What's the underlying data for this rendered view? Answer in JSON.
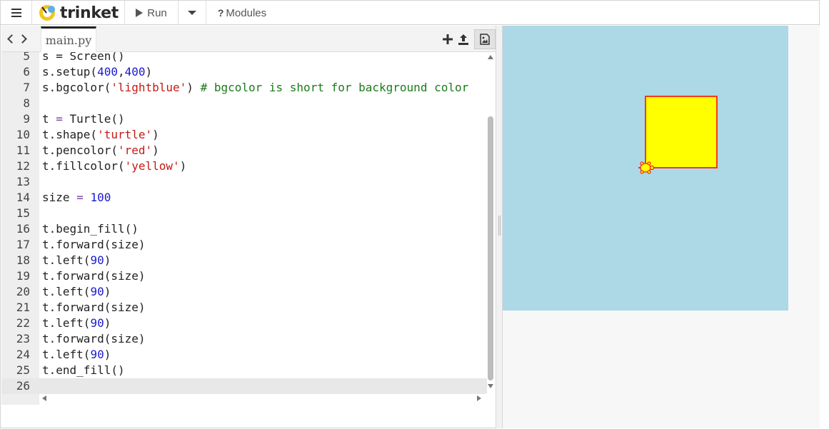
{
  "app": {
    "logo_text": "trinket"
  },
  "toolbar": {
    "run_label": "Run",
    "modules_q": "?",
    "modules_label": "Modules"
  },
  "editor": {
    "file_tab": "main.py",
    "lines": [
      {
        "n": "5",
        "tokens": [
          [
            "s = Screen()",
            ""
          ]
        ]
      },
      {
        "n": "6",
        "tokens": [
          [
            "s.setup(",
            ""
          ],
          [
            "400",
            "n"
          ],
          [
            ",",
            ""
          ],
          [
            "400",
            "n"
          ],
          [
            ")",
            ""
          ]
        ]
      },
      {
        "n": "7",
        "tokens": [
          [
            "s.bgcolor(",
            ""
          ],
          [
            "'lightblue'",
            "s"
          ],
          [
            ") ",
            ""
          ],
          [
            "# bgcolor is short for background color",
            "c"
          ]
        ]
      },
      {
        "n": "8",
        "tokens": []
      },
      {
        "n": "9",
        "tokens": [
          [
            "t ",
            ""
          ],
          [
            "=",
            "o"
          ],
          [
            " Turtle()",
            ""
          ]
        ]
      },
      {
        "n": "10",
        "tokens": [
          [
            "t.shape(",
            ""
          ],
          [
            "'turtle'",
            "s"
          ],
          [
            ")",
            ""
          ]
        ]
      },
      {
        "n": "11",
        "tokens": [
          [
            "t.pencolor(",
            ""
          ],
          [
            "'red'",
            "s"
          ],
          [
            ")",
            ""
          ]
        ]
      },
      {
        "n": "12",
        "tokens": [
          [
            "t.fillcolor(",
            ""
          ],
          [
            "'yellow'",
            "s"
          ],
          [
            ")",
            ""
          ]
        ]
      },
      {
        "n": "13",
        "tokens": []
      },
      {
        "n": "14",
        "tokens": [
          [
            "size ",
            ""
          ],
          [
            "=",
            "o"
          ],
          [
            " ",
            ""
          ],
          [
            "100",
            "n"
          ]
        ]
      },
      {
        "n": "15",
        "tokens": []
      },
      {
        "n": "16",
        "tokens": [
          [
            "t.begin_fill()",
            ""
          ]
        ]
      },
      {
        "n": "17",
        "tokens": [
          [
            "t.forward(size)",
            ""
          ]
        ]
      },
      {
        "n": "18",
        "tokens": [
          [
            "t.left(",
            ""
          ],
          [
            "90",
            "n"
          ],
          [
            ")",
            ""
          ]
        ]
      },
      {
        "n": "19",
        "tokens": [
          [
            "t.forward(size)",
            ""
          ]
        ]
      },
      {
        "n": "20",
        "tokens": [
          [
            "t.left(",
            ""
          ],
          [
            "90",
            "n"
          ],
          [
            ")",
            ""
          ]
        ]
      },
      {
        "n": "21",
        "tokens": [
          [
            "t.forward(size)",
            ""
          ]
        ]
      },
      {
        "n": "22",
        "tokens": [
          [
            "t.left(",
            ""
          ],
          [
            "90",
            "n"
          ],
          [
            ")",
            ""
          ]
        ]
      },
      {
        "n": "23",
        "tokens": [
          [
            "t.forward(size)",
            ""
          ]
        ]
      },
      {
        "n": "24",
        "tokens": [
          [
            "t.left(",
            ""
          ],
          [
            "90",
            "n"
          ],
          [
            ")",
            ""
          ]
        ]
      },
      {
        "n": "25",
        "tokens": [
          [
            "t.end_fill()",
            ""
          ]
        ]
      },
      {
        "n": "26",
        "tokens": [],
        "active": true
      }
    ]
  },
  "output": {
    "bgcolor": "#add8e6",
    "pencolor": "#ff0000",
    "fillcolor": "#ffff00",
    "turtle_color": "#ffff00"
  },
  "icons": [
    "menu-icon",
    "trinket-logo-icon",
    "play-icon",
    "caret-down-icon",
    "help-icon",
    "nav-back-icon",
    "nav-forward-icon",
    "add-file-icon",
    "upload-icon",
    "image-icon",
    "turtle-icon"
  ]
}
